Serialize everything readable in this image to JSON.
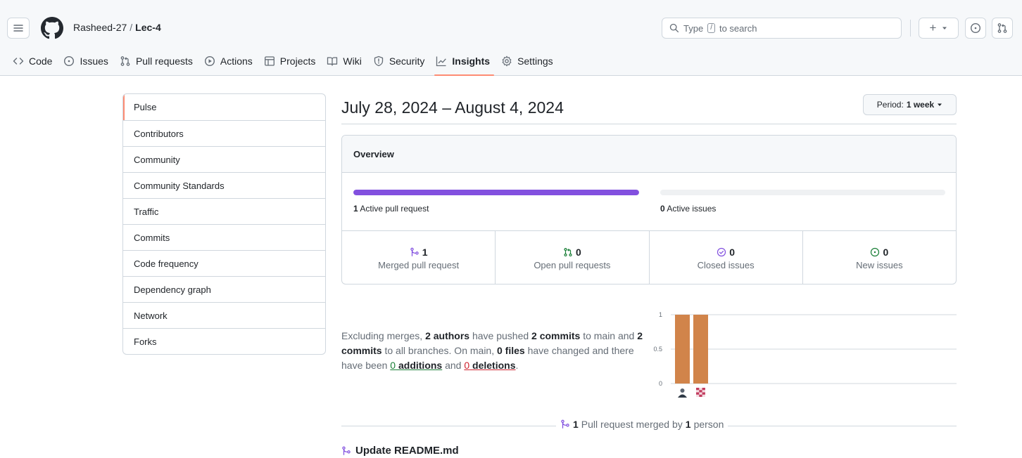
{
  "header": {
    "owner": "Rasheed-27",
    "separator": "/",
    "repo": "Lec-4",
    "search_prefix": "Type",
    "search_key": "/",
    "search_suffix": "to search",
    "new_label": "+",
    "brand_color": "#24292f"
  },
  "tabs": [
    {
      "label": "Code",
      "icon": "code-icon"
    },
    {
      "label": "Issues",
      "icon": "issue-opened-icon"
    },
    {
      "label": "Pull requests",
      "icon": "git-pull-request-icon"
    },
    {
      "label": "Actions",
      "icon": "play-icon"
    },
    {
      "label": "Projects",
      "icon": "table-icon"
    },
    {
      "label": "Wiki",
      "icon": "book-icon"
    },
    {
      "label": "Security",
      "icon": "shield-icon"
    },
    {
      "label": "Insights",
      "icon": "graph-icon",
      "active": true
    },
    {
      "label": "Settings",
      "icon": "gear-icon"
    }
  ],
  "sidebar": {
    "items": [
      {
        "label": "Pulse",
        "selected": true
      },
      {
        "label": "Contributors"
      },
      {
        "label": "Community"
      },
      {
        "label": "Community Standards"
      },
      {
        "label": "Traffic"
      },
      {
        "label": "Commits"
      },
      {
        "label": "Code frequency"
      },
      {
        "label": "Dependency graph"
      },
      {
        "label": "Network"
      },
      {
        "label": "Forks"
      }
    ]
  },
  "main": {
    "period_title": "July 28, 2024 – August 4, 2024",
    "period_prefix": "Period:",
    "period_value": "1 week",
    "overview": {
      "heading": "Overview",
      "active_prs_count": "1",
      "active_prs_label": "Active pull request",
      "active_prs_fraction": 1.0,
      "active_issues_count": "0",
      "active_issues_label": "Active issues",
      "active_issues_fraction": 0.0,
      "bar_color": "#8250df",
      "stats": [
        {
          "value": "1",
          "label": "Merged pull request",
          "icon": "git-merge-icon",
          "color": "#8250df"
        },
        {
          "value": "0",
          "label": "Open pull requests",
          "icon": "git-pull-request-icon",
          "color": "#1a7f37"
        },
        {
          "value": "0",
          "label": "Closed issues",
          "icon": "issue-closed-icon",
          "color": "#8250df"
        },
        {
          "value": "0",
          "label": "New issues",
          "icon": "issue-opened-icon",
          "color": "#1a7f37"
        }
      ]
    },
    "summary": {
      "t1": "Excluding merges,",
      "authors": "2 authors",
      "t2": "have pushed",
      "commits_main": "2 commits",
      "t3": "to main and",
      "commits_all": "2 commits",
      "t4": "to all branches. On main,",
      "files": "0 files",
      "t5": "have changed and there have been",
      "additions_num": "0",
      "additions_word": "additions",
      "t6": "and",
      "deletions_num": "0",
      "deletions_word": "deletions",
      "t7": "."
    },
    "merged": {
      "count": "1",
      "text1": "Pull request merged by",
      "people": "1",
      "text2": "person"
    },
    "pr_title": "Update README.md"
  },
  "chart_data": {
    "type": "bar",
    "categories": [
      "author-1",
      "author-2"
    ],
    "values": [
      1,
      1
    ],
    "yticks": [
      "0",
      "0.5",
      "1"
    ],
    "ylim": [
      0,
      1
    ],
    "bar_color": "#d1844a",
    "grid": true
  }
}
